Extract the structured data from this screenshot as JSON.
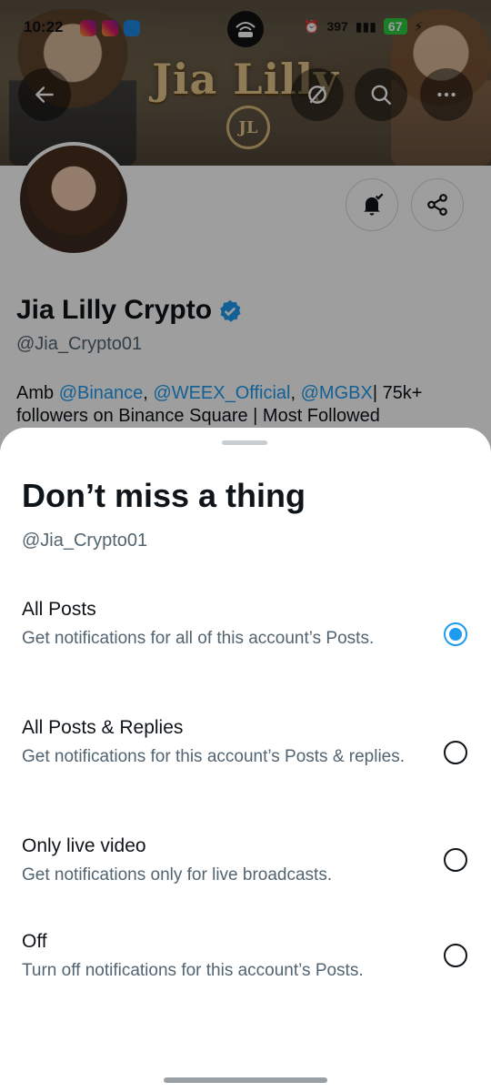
{
  "status_bar": {
    "time": "10:22",
    "net_speed": "397",
    "battery": "67"
  },
  "banner": {
    "title": "Jia Lilly",
    "monogram": "JL"
  },
  "profile": {
    "name": "Jia Lilly Crypto",
    "handle": "@Jia_Crypto01",
    "bio_prefix": "Amb ",
    "mention_1": "@Binance",
    "sep_1": ", ",
    "mention_2": "@WEEX_Official",
    "sep_2": ", ",
    "mention_3": "@MGBX",
    "bio_suffix": "| 75k+ followers on Binance Square | Most Followed"
  },
  "sheet": {
    "title": "Don’t miss a thing",
    "handle": "@Jia_Crypto01",
    "options": [
      {
        "title": "All Posts",
        "desc": "Get notifications for all of this account’s Posts.",
        "selected": true
      },
      {
        "title": "All Posts & Replies",
        "desc": "Get notifications for this account’s Posts & replies.",
        "selected": false
      },
      {
        "title": "Only live video",
        "desc": "Get notifications only for live broadcasts.",
        "selected": false
      },
      {
        "title": "Off",
        "desc": "Turn off notifications for this account’s Posts.",
        "selected": false
      }
    ]
  },
  "colors": {
    "accent": "#1d9bf0",
    "text_primary": "#0f1419",
    "text_secondary": "#536471"
  }
}
